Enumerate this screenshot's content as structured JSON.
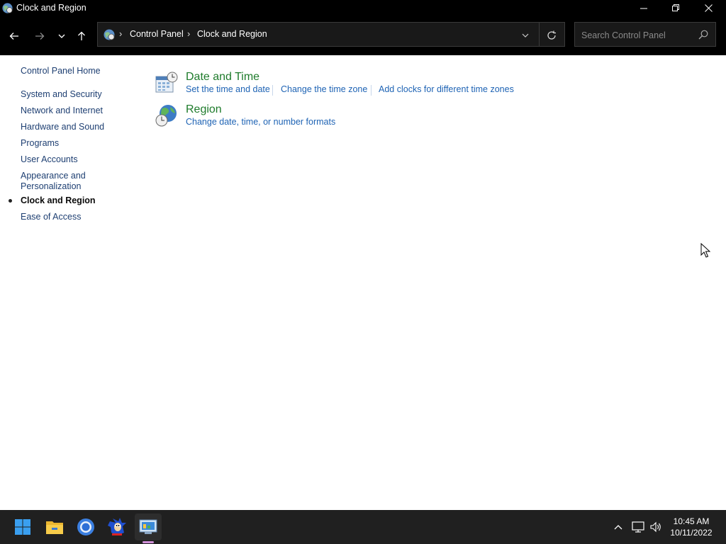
{
  "window": {
    "title": "Clock and Region"
  },
  "address": {
    "breadcrumbs": [
      "Control Panel",
      "Clock and Region"
    ]
  },
  "search": {
    "placeholder": "Search Control Panel"
  },
  "leftnav": {
    "items": [
      {
        "label": "Control Panel Home"
      },
      {
        "label": "System and Security"
      },
      {
        "label": "Network and Internet"
      },
      {
        "label": "Hardware and Sound"
      },
      {
        "label": "Programs"
      },
      {
        "label": "User Accounts"
      },
      {
        "label": "Appearance and"
      },
      {
        "label": "Personalization"
      },
      {
        "label": "Clock and Region",
        "active": true
      },
      {
        "label": "Ease of Access"
      }
    ]
  },
  "categories": [
    {
      "title": "Date and Time",
      "icon": "date-time-icon",
      "links": [
        "Set the time and date",
        "Change the time zone",
        "Add clocks for different time zones"
      ]
    },
    {
      "title": "Region",
      "icon": "region-globe-icon",
      "links": [
        "Change date, time, or number formats"
      ]
    }
  ],
  "taskbar": {
    "apps": [
      "start-icon",
      "file-explorer-icon",
      "chrome-icon",
      "sonic-icon",
      "control-panel-icon"
    ],
    "active_app": "control-panel-icon"
  },
  "tray": {
    "time": "10:45 AM",
    "date": "10/11/2022"
  },
  "colors": {
    "link": "#1e63b4",
    "category_title": "#1e7b2b",
    "titlebar_bg": "#000000",
    "taskbar_bg": "#202020"
  }
}
